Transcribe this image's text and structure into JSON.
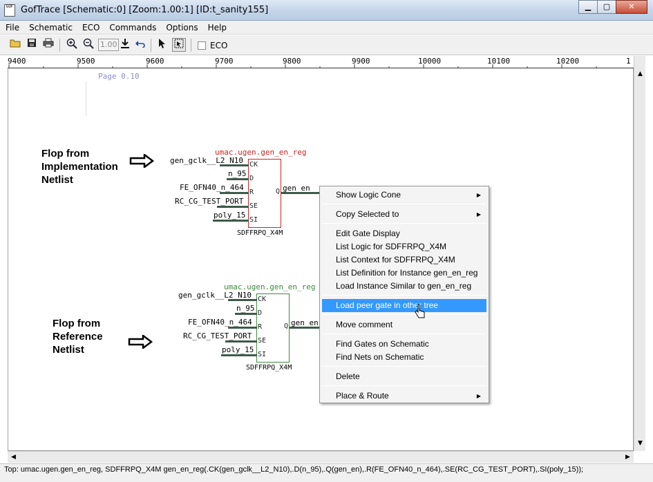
{
  "window": {
    "title": "GofTrace [Schematic:0] [Zoom:1.00:1] [ID:t_sanity155]",
    "app_icon_text": "GOF",
    "minimize": "▁",
    "maximize": "▢",
    "close": "✕"
  },
  "menubar": [
    "File",
    "Schematic",
    "ECO",
    "Commands",
    "Options",
    "Help"
  ],
  "toolbar": {
    "zoom_value": "1.00",
    "eco_label": "ECO",
    "eco_checked": false,
    "icons": [
      "open-folder-icon",
      "save-icon",
      "print-icon",
      "zoom-in-icon",
      "zoom-out-icon",
      "download-icon",
      "undo-icon",
      "pointer-icon",
      "select-area-icon"
    ]
  },
  "ruler": {
    "labels": [
      "9400",
      "9500",
      "9600",
      "9700",
      "9800",
      "9900",
      "10000",
      "10100",
      "10200",
      "1"
    ]
  },
  "schematic": {
    "page_label": "Page 0.10",
    "annotation_impl": "Flop from\nImplementation\nNetlist",
    "annotation_ref": "Flop from\nReference\nNetlist",
    "top_gate": {
      "instance": "umac.ugen.gen_en_reg",
      "cell": "SDFFRPQ_X4M",
      "border_color": "#d02020",
      "instance_color": "#d02020",
      "inputs": [
        "gen_gclk__L2_N10",
        "n_95",
        "FE_OFN40_n_464",
        "RC_CG_TEST_PORT",
        "poly_15"
      ],
      "pins": [
        "CK",
        "D",
        "R",
        "SE",
        "SI"
      ],
      "output_pin": "Q",
      "output_net": "gen_en"
    },
    "bottom_gate": {
      "instance": "umac.ugen.gen_en_reg",
      "cell": "SDFFRPQ_X4M",
      "border_color": "#3c8a3c",
      "instance_color": "#3c8a3c",
      "inputs": [
        "gen_gclk__L2_N10",
        "n_95",
        "FE_OFN40_n_464",
        "RC_CG_TEST_PORT",
        "poly_15"
      ],
      "pins": [
        "CK",
        "D",
        "R",
        "SE",
        "SI"
      ],
      "output_pin": "Q",
      "output_net": "gen_en"
    }
  },
  "context_menu": {
    "items": [
      {
        "label": "Show Logic Cone",
        "submenu": true
      },
      {
        "label": "Copy Selected to",
        "submenu": true
      },
      {
        "label": "Edit Gate Display"
      },
      {
        "label": "List Logic for SDFFRPQ_X4M"
      },
      {
        "label": "List Context for SDFFRPQ_X4M"
      },
      {
        "label": "List Definition for Instance gen_en_reg"
      },
      {
        "label": "Load Instance Similar to gen_en_reg"
      },
      {
        "label": "Load peer gate in other tree",
        "highlighted": true
      },
      {
        "label": "Move comment"
      },
      {
        "label": "Find Gates on Schematic"
      },
      {
        "label": "Find Nets on Schematic"
      },
      {
        "label": "Delete"
      },
      {
        "label": "Place & Route",
        "submenu": true
      }
    ]
  },
  "status_bar": "Top: umac.ugen.gen_en_reg, SDFFRPQ_X4M gen_en_reg(.CK(gen_gclk__L2_N10),.D(n_95),.Q(gen_en),.R(FE_OFN40_n_464),.SE(RC_CG_TEST_PORT),.SI(poly_15));",
  "colors": {
    "highlight": "#3399ff",
    "page_label": "#8a8ad6",
    "net_line": "#3d5a4a"
  }
}
